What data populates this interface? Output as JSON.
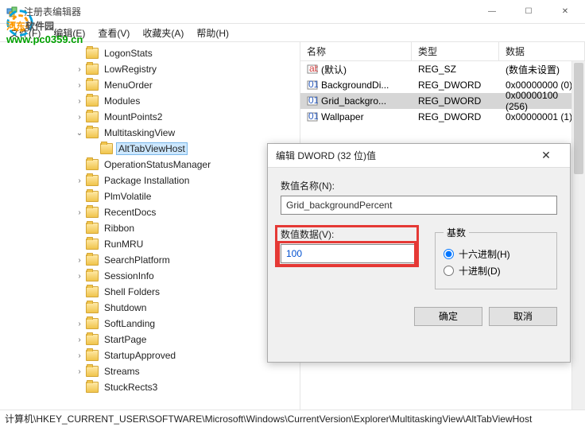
{
  "window": {
    "title": "注册表编辑器"
  },
  "watermark": {
    "line1a": "河东",
    "line1b": "软件园",
    "line2": "www.pc0359.cn"
  },
  "menu": {
    "file": "文件(F)",
    "edit": "编辑(E)",
    "view": "查看(V)",
    "fav": "收藏夹(A)",
    "help": "帮助(H)"
  },
  "tree": {
    "items": [
      {
        "indent": 5,
        "label": "LogonStats"
      },
      {
        "indent": 5,
        "label": "LowRegistry",
        "exp": ">"
      },
      {
        "indent": 5,
        "label": "MenuOrder",
        "exp": ">"
      },
      {
        "indent": 5,
        "label": "Modules",
        "exp": ">"
      },
      {
        "indent": 5,
        "label": "MountPoints2",
        "exp": ">"
      },
      {
        "indent": 5,
        "label": "MultitaskingView",
        "exp": "v",
        "open": true
      },
      {
        "indent": 6,
        "label": "AltTabViewHost",
        "selected": true
      },
      {
        "indent": 5,
        "label": "OperationStatusManager"
      },
      {
        "indent": 5,
        "label": "Package Installation",
        "exp": ">"
      },
      {
        "indent": 5,
        "label": "PlmVolatile"
      },
      {
        "indent": 5,
        "label": "RecentDocs",
        "exp": ">"
      },
      {
        "indent": 5,
        "label": "Ribbon"
      },
      {
        "indent": 5,
        "label": "RunMRU"
      },
      {
        "indent": 5,
        "label": "SearchPlatform",
        "exp": ">"
      },
      {
        "indent": 5,
        "label": "SessionInfo",
        "exp": ">"
      },
      {
        "indent": 5,
        "label": "Shell Folders"
      },
      {
        "indent": 5,
        "label": "Shutdown"
      },
      {
        "indent": 5,
        "label": "SoftLanding",
        "exp": ">"
      },
      {
        "indent": 5,
        "label": "StartPage",
        "exp": ">"
      },
      {
        "indent": 5,
        "label": "StartupApproved",
        "exp": ">"
      },
      {
        "indent": 5,
        "label": "Streams",
        "exp": ">"
      },
      {
        "indent": 5,
        "label": "StuckRects3"
      }
    ]
  },
  "list": {
    "headers": {
      "name": "名称",
      "type": "类型",
      "data": "数据"
    },
    "rows": [
      {
        "icon": "str",
        "name": "(默认)",
        "type": "REG_SZ",
        "data": "(数值未设置)"
      },
      {
        "icon": "bin",
        "name": "BackgroundDi...",
        "type": "REG_DWORD",
        "data": "0x00000000 (0)"
      },
      {
        "icon": "bin",
        "name": "Grid_backgro...",
        "type": "REG_DWORD",
        "data": "0x00000100 (256)",
        "selected": true
      },
      {
        "icon": "bin",
        "name": "Wallpaper",
        "type": "REG_DWORD",
        "data": "0x00000001 (1)"
      }
    ]
  },
  "dialog": {
    "title": "编辑 DWORD (32 位)值",
    "name_label": "数值名称(N):",
    "name_value": "Grid_backgroundPercent",
    "value_label": "数值数据(V):",
    "value_data": "100",
    "radix_label": "基数",
    "radix_hex": "十六进制(H)",
    "radix_dec": "十进制(D)",
    "ok": "确定",
    "cancel": "取消"
  },
  "status": {
    "path": "计算机\\HKEY_CURRENT_USER\\SOFTWARE\\Microsoft\\Windows\\CurrentVersion\\Explorer\\MultitaskingView\\AltTabViewHost"
  }
}
